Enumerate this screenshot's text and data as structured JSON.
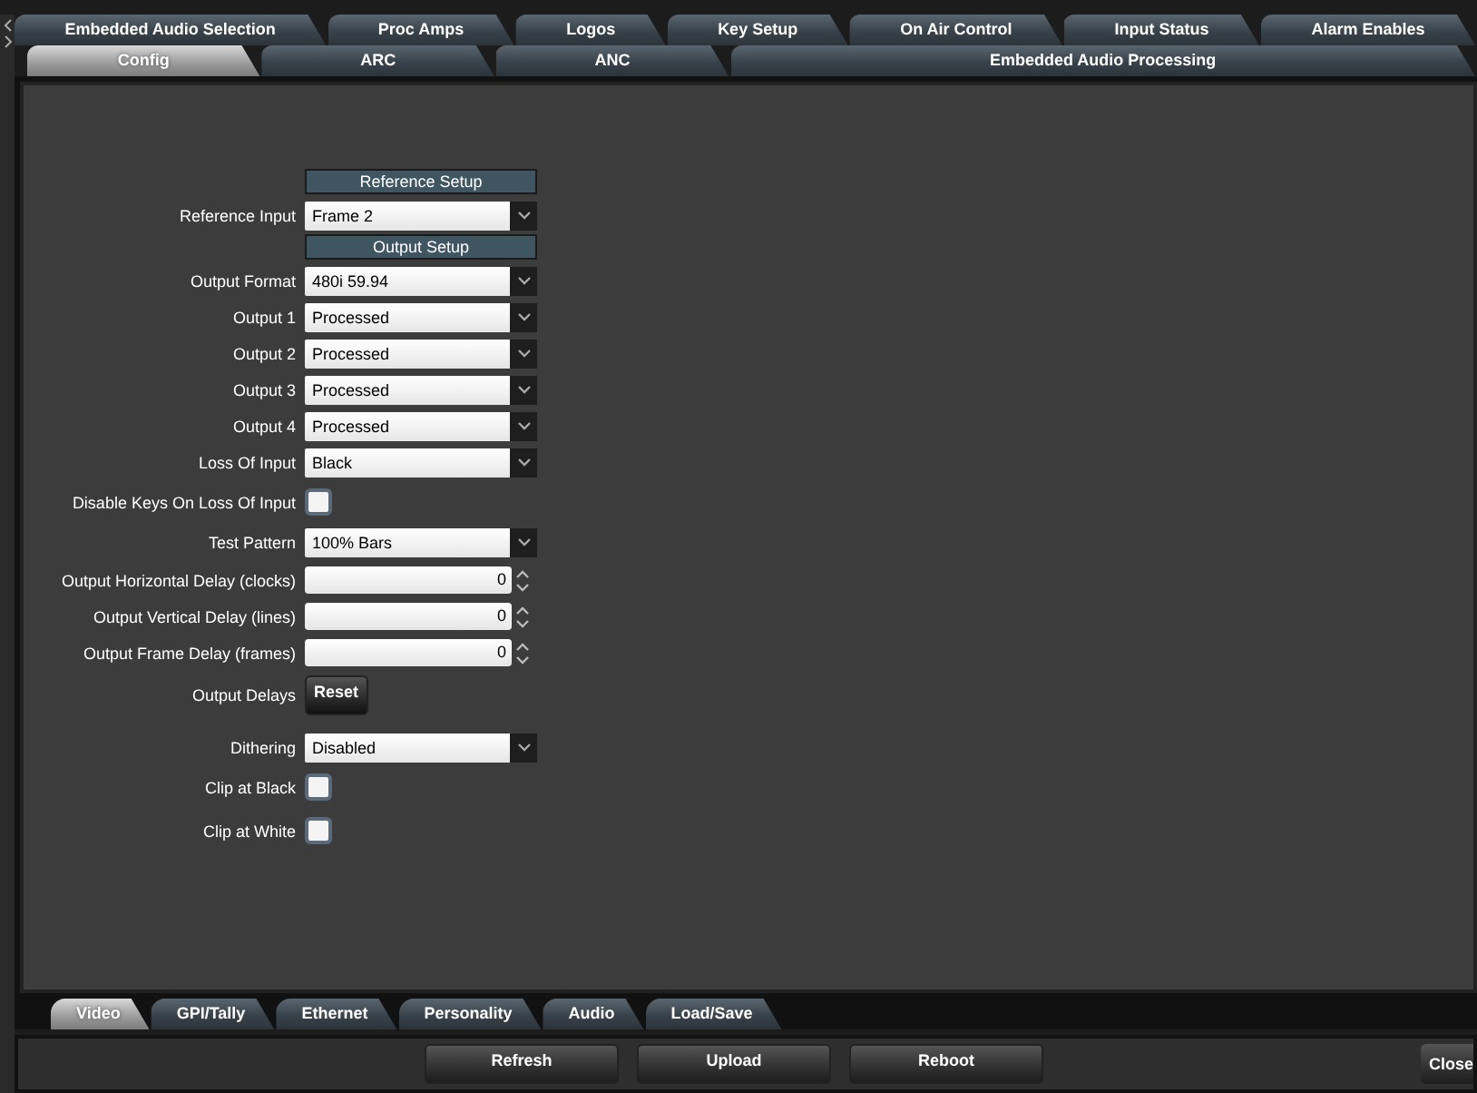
{
  "top_tabs": [
    {
      "label": "Embedded Audio Selection",
      "selected": false
    },
    {
      "label": "Proc Amps",
      "selected": false
    },
    {
      "label": "Logos",
      "selected": false
    },
    {
      "label": "Key Setup",
      "selected": false
    },
    {
      "label": "On Air Control",
      "selected": false
    },
    {
      "label": "Input Status",
      "selected": false
    },
    {
      "label": "Alarm Enables",
      "selected": false
    }
  ],
  "sub_tabs": [
    {
      "label": "Config",
      "selected": true
    },
    {
      "label": "ARC",
      "selected": false
    },
    {
      "label": "ANC",
      "selected": false
    },
    {
      "label": "Embedded Audio Processing",
      "selected": false
    }
  ],
  "form": [
    {
      "kind": "header",
      "label": "Reference Setup"
    },
    {
      "kind": "select",
      "label": "Reference Input",
      "value": "Frame 2"
    },
    {
      "kind": "header",
      "label": "Output Setup"
    },
    {
      "kind": "select",
      "label": "Output Format",
      "value": "480i 59.94"
    },
    {
      "kind": "select",
      "label": "Output 1",
      "value": "Processed"
    },
    {
      "kind": "select",
      "label": "Output 2",
      "value": "Processed"
    },
    {
      "kind": "select",
      "label": "Output 3",
      "value": "Processed"
    },
    {
      "kind": "select",
      "label": "Output 4",
      "value": "Processed"
    },
    {
      "kind": "select",
      "label": "Loss Of Input",
      "value": "Black"
    },
    {
      "kind": "checkbox",
      "label": "Disable Keys On Loss Of Input",
      "checked": false
    },
    {
      "kind": "select",
      "label": "Test Pattern",
      "value": "100% Bars"
    },
    {
      "kind": "spinner",
      "label": "Output Horizontal Delay (clocks)",
      "value": "0"
    },
    {
      "kind": "spinner",
      "label": "Output Vertical Delay (lines)",
      "value": "0"
    },
    {
      "kind": "spinner",
      "label": "Output Frame Delay (frames)",
      "value": "0"
    },
    {
      "kind": "button",
      "label": "Output Delays",
      "button": "Reset"
    },
    {
      "kind": "select",
      "label": "Dithering",
      "value": "Disabled"
    },
    {
      "kind": "checkbox",
      "label": "Clip at Black",
      "checked": false
    },
    {
      "kind": "checkbox",
      "label": "Clip at White",
      "checked": false
    }
  ],
  "bottom_tabs": [
    {
      "label": "Video",
      "selected": true
    },
    {
      "label": "GPI/Tally",
      "selected": false
    },
    {
      "label": "Ethernet",
      "selected": false
    },
    {
      "label": "Personality",
      "selected": false
    },
    {
      "label": "Audio",
      "selected": false
    },
    {
      "label": "Load/Save",
      "selected": false
    }
  ],
  "footer_buttons": [
    "Refresh",
    "Upload",
    "Reboot"
  ],
  "close_button": "Close"
}
